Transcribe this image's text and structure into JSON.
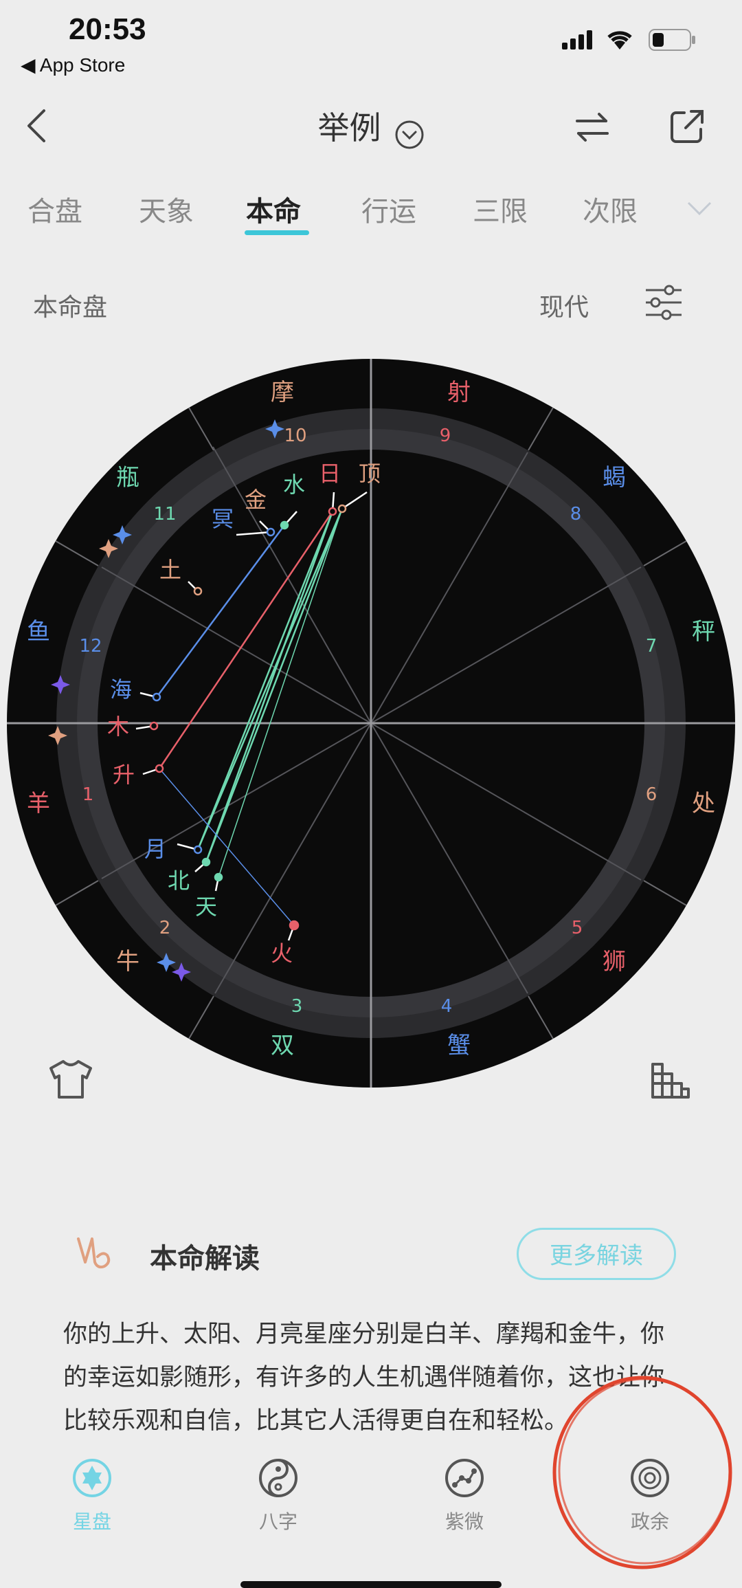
{
  "status": {
    "time": "20:53",
    "back_app": "App Store"
  },
  "header": {
    "title": "举例"
  },
  "tabs": [
    "合盘",
    "天象",
    "本命",
    "行运",
    "三限",
    "次限"
  ],
  "active_tab": 2,
  "section": {
    "title": "本命盘",
    "mode": "现代"
  },
  "chart": {
    "signs": [
      "羊",
      "牛",
      "双",
      "蟹",
      "狮",
      "处",
      "秤",
      "蝎",
      "射",
      "摩",
      "瓶",
      "鱼"
    ],
    "houses": [
      "1",
      "2",
      "3",
      "4",
      "5",
      "6",
      "7",
      "8",
      "9",
      "10",
      "11",
      "12"
    ],
    "planets": {
      "sun": "日",
      "mc": "顶",
      "mercury": "水",
      "venus": "金",
      "pluto": "冥",
      "saturn": "土",
      "neptune": "海",
      "jupiter": "木",
      "asc": "升",
      "moon": "月",
      "north_node": "北",
      "uranus": "天",
      "mars": "火"
    }
  },
  "reading": {
    "title": "本命解读",
    "more": "更多解读",
    "lines": [
      "你的上升、太阳、月亮星座分别是白羊、摩羯和金牛，你",
      "的幸运如影随形，有许多的人生机遇伴随着你，这也让你",
      "比较乐观和自信，比其它人活得更自在和轻松。"
    ]
  },
  "nav": [
    {
      "label": "星盘",
      "icon": "star-of-david-icon"
    },
    {
      "label": "八字",
      "icon": "yin-yang-icon"
    },
    {
      "label": "紫微",
      "icon": "constellation-icon"
    },
    {
      "label": "政余",
      "icon": "compass-wheel-icon"
    }
  ],
  "colors": {
    "accent": "#3cc6d8",
    "fire": "#e8606a",
    "earth": "#e0a080",
    "air": "#6ed8b0",
    "water": "#5a8ee8"
  }
}
